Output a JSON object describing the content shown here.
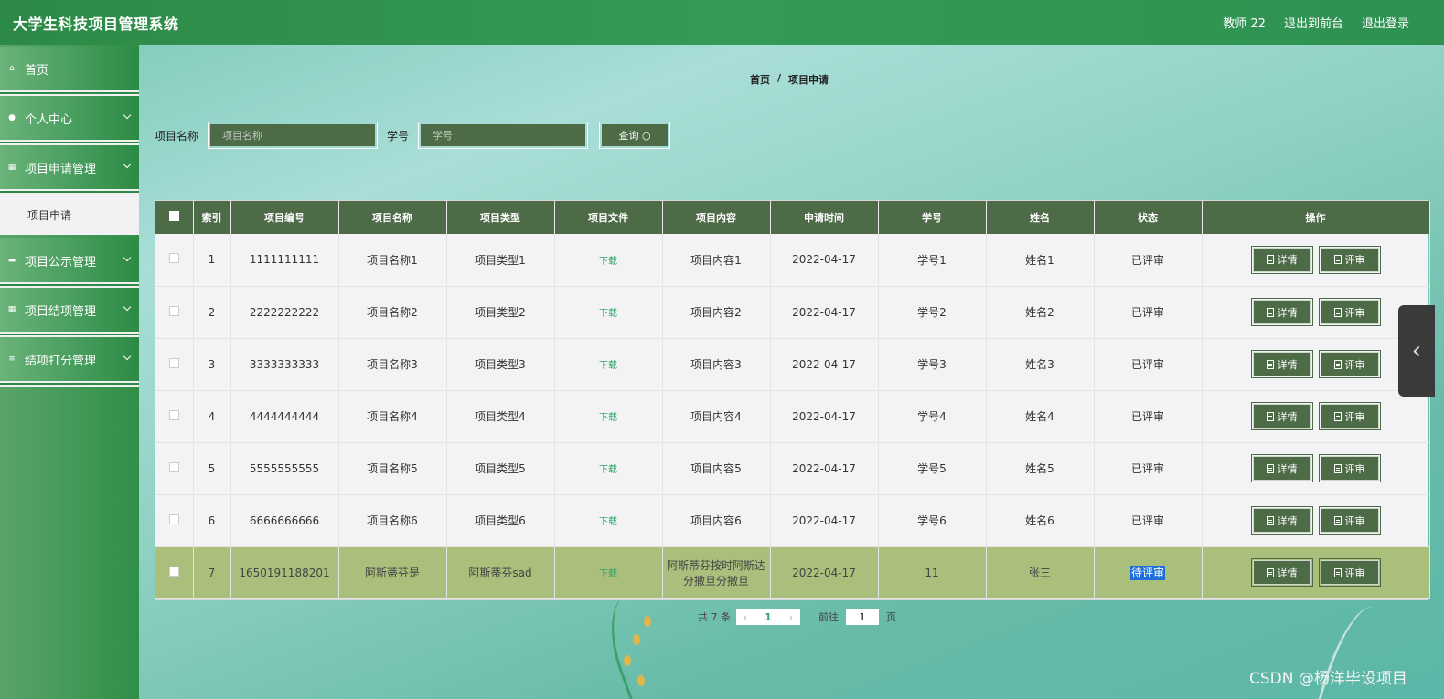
{
  "app": {
    "title": "大学生科技项目管理系统"
  },
  "topbar": {
    "user": "教师 22",
    "back_front": "退出到前台",
    "logout": "退出登录"
  },
  "sidebar": {
    "home": "首页",
    "personal": "个人中心",
    "apply_mgmt": "项目申请管理",
    "apply_sub": "项目申请",
    "publicity_mgmt": "项目公示管理",
    "conclusion_mgmt": "项目结项管理",
    "scoring_mgmt": "结项打分管理"
  },
  "breadcrumb": {
    "home": "首页",
    "sep": "/",
    "current": "项目申请"
  },
  "search": {
    "name_label": "项目名称",
    "name_placeholder": "项目名称",
    "sid_label": "学号",
    "sid_placeholder": "学号",
    "query_label": "查询"
  },
  "table": {
    "headers": [
      "索引",
      "项目编号",
      "项目名称",
      "项目类型",
      "项目文件",
      "项目内容",
      "申请时间",
      "学号",
      "姓名",
      "状态",
      "操作"
    ],
    "rows": [
      {
        "index": "1",
        "code": "1111111111",
        "name": "项目名称1",
        "type": "项目类型1",
        "file": "下载",
        "content": "项目内容1",
        "date": "2022-04-17",
        "sid": "学号1",
        "student": "姓名1",
        "status": "已评审"
      },
      {
        "index": "2",
        "code": "2222222222",
        "name": "项目名称2",
        "type": "项目类型2",
        "file": "下载",
        "content": "项目内容2",
        "date": "2022-04-17",
        "sid": "学号2",
        "student": "姓名2",
        "status": "已评审"
      },
      {
        "index": "3",
        "code": "3333333333",
        "name": "项目名称3",
        "type": "项目类型3",
        "file": "下载",
        "content": "项目内容3",
        "date": "2022-04-17",
        "sid": "学号3",
        "student": "姓名3",
        "status": "已评审"
      },
      {
        "index": "4",
        "code": "4444444444",
        "name": "项目名称4",
        "type": "项目类型4",
        "file": "下载",
        "content": "项目内容4",
        "date": "2022-04-17",
        "sid": "学号4",
        "student": "姓名4",
        "status": "已评审"
      },
      {
        "index": "5",
        "code": "5555555555",
        "name": "项目名称5",
        "type": "项目类型5",
        "file": "下载",
        "content": "项目内容5",
        "date": "2022-04-17",
        "sid": "学号5",
        "student": "姓名5",
        "status": "已评审"
      },
      {
        "index": "6",
        "code": "6666666666",
        "name": "项目名称6",
        "type": "项目类型6",
        "file": "下载",
        "content": "项目内容6",
        "date": "2022-04-17",
        "sid": "学号6",
        "student": "姓名6",
        "status": "已评审"
      },
      {
        "index": "7",
        "code": "1650191188201",
        "name": "阿斯蒂芬是",
        "type": "阿斯蒂芬sad",
        "file": "下载",
        "content": "阿斯蒂芬按时阿斯达分撒旦分撒旦",
        "date": "2022-04-17",
        "sid": "11",
        "student": "张三",
        "status": "待评审"
      }
    ],
    "detail_label": "详情",
    "review_label": "评审"
  },
  "pager": {
    "total": "共 7 条",
    "current_page": "1",
    "goto_label": "前往",
    "goto_value": "1",
    "page_unit": "页"
  },
  "watermark": "CSDN @杨洋毕设项目",
  "colors": {
    "topbar": "#2c8a46",
    "dark_green": "#4e6b48",
    "highlight_row": "#a9bf7b",
    "selected_text": "#1e6fd9"
  }
}
